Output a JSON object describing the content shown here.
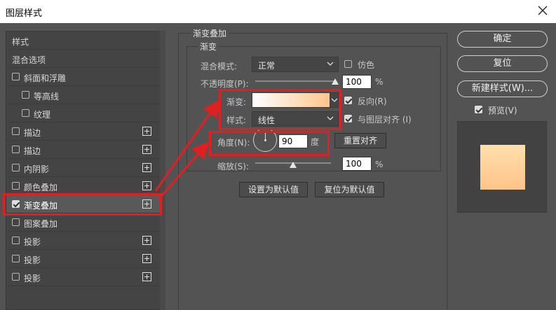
{
  "window": {
    "title": "图层样式"
  },
  "styles_list": {
    "header": "样式",
    "blend_options": "混合选项",
    "items": [
      {
        "label": "斜面和浮雕",
        "checked": false,
        "plus": false,
        "indent": false
      },
      {
        "label": "等高线",
        "checked": false,
        "plus": false,
        "indent": true
      },
      {
        "label": "纹理",
        "checked": false,
        "plus": false,
        "indent": true
      },
      {
        "label": "描边",
        "checked": false,
        "plus": true,
        "indent": false
      },
      {
        "label": "描边",
        "checked": false,
        "plus": true,
        "indent": false
      },
      {
        "label": "内阴影",
        "checked": false,
        "plus": true,
        "indent": false
      },
      {
        "label": "颜色叠加",
        "checked": false,
        "plus": true,
        "indent": false
      },
      {
        "label": "渐变叠加",
        "checked": true,
        "plus": true,
        "indent": false,
        "selected": true
      },
      {
        "label": "图案叠加",
        "checked": false,
        "plus": false,
        "indent": false
      },
      {
        "label": "投影",
        "checked": false,
        "plus": true,
        "indent": false
      },
      {
        "label": "投影",
        "checked": false,
        "plus": true,
        "indent": false
      },
      {
        "label": "投影",
        "checked": false,
        "plus": true,
        "indent": false
      }
    ]
  },
  "gradient_overlay": {
    "group_title": "渐变叠加",
    "section_title": "渐变",
    "blend_mode_label": "混合模式:",
    "blend_mode_value": "正常",
    "dither_label": "仿色",
    "dither_checked": false,
    "opacity_label": "不透明度(P):",
    "opacity_value": "100",
    "opacity_unit": "%",
    "opacity_level": 1.0,
    "gradient_label": "渐变:",
    "gradient_colors": [
      "#ffffff",
      "#ffc48a"
    ],
    "reverse_label": "反向(R)",
    "reverse_checked": true,
    "style_label": "样式:",
    "style_value": "线性",
    "align_label": "与图层对齐 (I)",
    "align_checked": true,
    "angle_label": "角度(N):",
    "angle_value": "90",
    "angle_unit": "度",
    "reset_align_button": "重置对齐",
    "scale_label": "缩放(S):",
    "scale_value": "100",
    "scale_unit": "%",
    "scale_level": 0.5,
    "set_default_button": "设置为默认值",
    "reset_default_button": "复位为默认值"
  },
  "actions": {
    "ok": "确定",
    "reset": "复位",
    "new_style": "新建样式(W)...",
    "preview_label": "预览(V)",
    "preview_checked": true
  },
  "colors": {
    "annotation_red": "#e02020",
    "dialog_bg": "#535353",
    "gradient_start": "#ffffff",
    "gradient_end": "#ffc48a"
  }
}
